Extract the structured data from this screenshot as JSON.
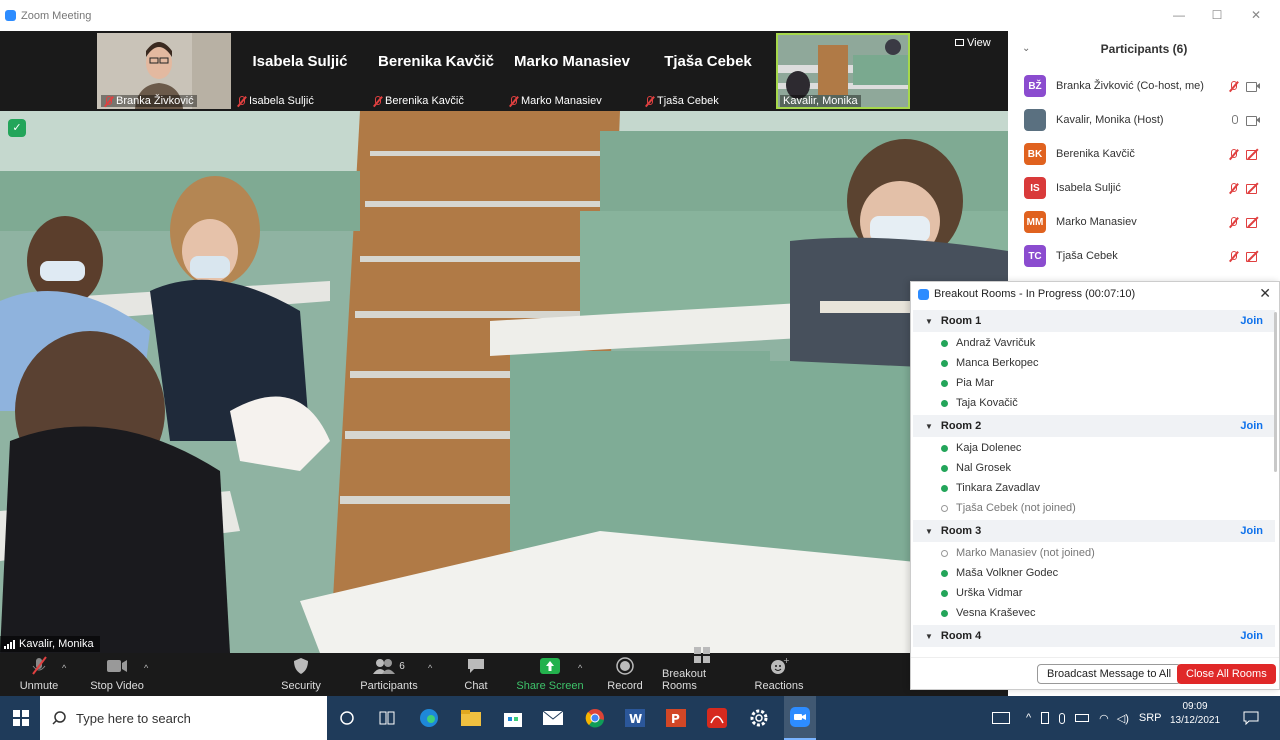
{
  "window": {
    "title": "Zoom Meeting",
    "controls": {
      "minimize": "—",
      "maximize": "☐",
      "close": "✕"
    }
  },
  "top_strip": {
    "view_label": "View",
    "thumbnails": [
      {
        "name": "Branka Živković",
        "label": "Branka Živković",
        "type": "video"
      },
      {
        "name": "Isabela Suljić",
        "label": "Isabela Suljić",
        "type": "name"
      },
      {
        "name": "Berenika Kavčič",
        "label": "Berenika Kavčič",
        "type": "name"
      },
      {
        "name": "Marko Manasiev",
        "label": "Marko Manasiev",
        "type": "name"
      },
      {
        "name": "Tjaša Cebek",
        "label": "Tjaša Cebek",
        "type": "name"
      },
      {
        "name": "Kavalir, Monika",
        "label": "Kavalir, Monika",
        "type": "video"
      }
    ]
  },
  "main_video": {
    "speaker_label": "Kavalir, Monika"
  },
  "toolbar": {
    "unmute": "Unmute",
    "stop_video": "Stop Video",
    "security": "Security",
    "participants": "Participants",
    "participants_count": "6",
    "chat": "Chat",
    "share_screen": "Share Screen",
    "record": "Record",
    "breakout_rooms": "Breakout Rooms",
    "reactions": "Reactions"
  },
  "participants_panel": {
    "title": "Participants (6)",
    "list": [
      {
        "initials": "BŽ",
        "name": "Branka Živković (Co-host, me)",
        "color": "#8b4ccf",
        "mic": "off",
        "video": "on"
      },
      {
        "initials": "",
        "name": "Kavalir, Monika (Host)",
        "color": "#5a7080",
        "mic": "on",
        "video": "on"
      },
      {
        "initials": "BK",
        "name": "Berenika Kavčič",
        "color": "#e0621f",
        "mic": "off",
        "video": "off"
      },
      {
        "initials": "IS",
        "name": "Isabela Suljić",
        "color": "#d93a3a",
        "mic": "off",
        "video": "off"
      },
      {
        "initials": "MM",
        "name": "Marko Manasiev",
        "color": "#e0621f",
        "mic": "off",
        "video": "off"
      },
      {
        "initials": "TC",
        "name": "Tjaša Cebek",
        "color": "#8b4ccf",
        "mic": "off",
        "video": "off"
      }
    ]
  },
  "breakout": {
    "title": "Breakout Rooms - In Progress (00:07:10)",
    "join_label": "Join",
    "rooms": [
      {
        "name": "Room 1",
        "members": [
          {
            "name": "Andraž Vavričuk",
            "joined": true
          },
          {
            "name": "Manca Berkopec",
            "joined": true
          },
          {
            "name": "Pia Mar",
            "joined": true
          },
          {
            "name": "Taja Kovačič",
            "joined": true
          }
        ]
      },
      {
        "name": "Room 2",
        "members": [
          {
            "name": "Kaja Dolenec",
            "joined": true
          },
          {
            "name": "Nal Grosek",
            "joined": true
          },
          {
            "name": "Tinkara Zavadlav",
            "joined": true
          },
          {
            "name": "Tjaša Cebek (not joined)",
            "joined": false
          }
        ]
      },
      {
        "name": "Room 3",
        "members": [
          {
            "name": "Marko Manasiev (not joined)",
            "joined": false
          },
          {
            "name": "Maša Volkner Godec",
            "joined": true
          },
          {
            "name": "Urška Vidmar",
            "joined": true
          },
          {
            "name": "Vesna Kraševec",
            "joined": true
          }
        ]
      },
      {
        "name": "Room 4",
        "members": []
      }
    ],
    "broadcast_label": "Broadcast Message to All",
    "close_all_label": "Close All Rooms"
  },
  "taskbar": {
    "search_placeholder": "Type here to search",
    "language": "SRP",
    "time": "09:09",
    "date": "13/12/2021"
  }
}
